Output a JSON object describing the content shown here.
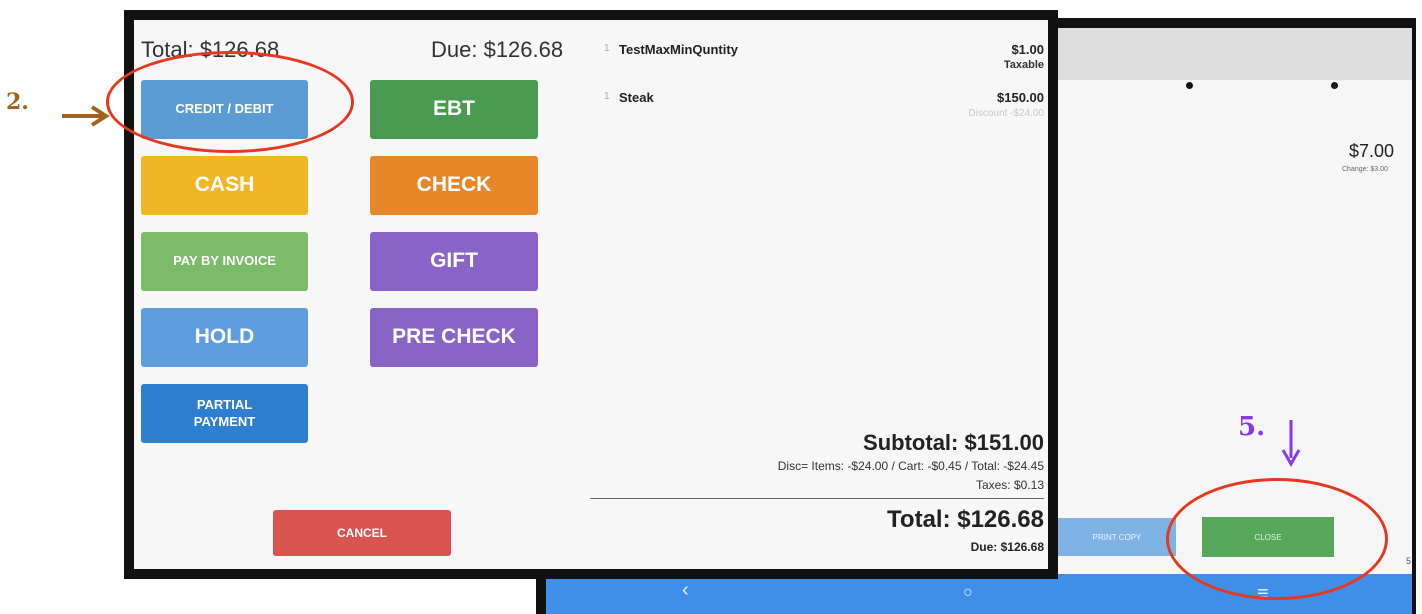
{
  "header": {
    "total": "Total: $126.68",
    "due": "Due: $126.68"
  },
  "payment_buttons": {
    "credit_debit": "CREDIT / DEBIT",
    "ebt": "EBT",
    "cash": "CASH",
    "check": "CHECK",
    "pay_by_invoice": "PAY BY INVOICE",
    "gift": "GIFT",
    "hold": "HOLD",
    "pre_check": "PRE CHECK",
    "partial_payment": "PARTIAL PAYMENT",
    "cancel": "CANCEL"
  },
  "cart": {
    "items": [
      {
        "prefix": "1",
        "name": "TestMaxMinQuntity",
        "price": "$1.00",
        "sub": "Taxable",
        "discount": ""
      },
      {
        "prefix": "1",
        "name": "Steak",
        "price": "$150.00",
        "sub": "",
        "discount": "Discount -$24.00"
      }
    ],
    "subtotal": "Subtotal: $151.00",
    "discount_line": "Disc= Items: -$24.00 / Cart: -$0.45 / Total: -$24.45",
    "taxes": "Taxes: $0.13",
    "total": "Total: $126.68",
    "due": "Due: $126.68"
  },
  "back_screen": {
    "amount": "$7.00",
    "change": "Change: $3.00",
    "print_copy_label": "PRINT COPY",
    "close_label": "CLOSE",
    "side_number": "5"
  },
  "android_nav": {
    "back_glyph": "‹",
    "home_glyph": "○",
    "menu_glyph": "≡"
  },
  "annotations": {
    "step2": "2.",
    "step5": "5."
  },
  "colors": {
    "credit_debit": "#5b9bd5",
    "ebt": "#4a9a4f",
    "cash": "#f0b623",
    "check": "#e8862a",
    "pay_by_invoice": "#7cbb6a",
    "gift": "#8a63c6",
    "hold": "#5f9ede",
    "pre_check": "#8a63c6",
    "partial_payment": "#2f7fd0",
    "cancel": "#d9534f",
    "annotation_red": "#e5381f",
    "step2_brown": "#a0631b",
    "step5_purple": "#8a38f0",
    "android_nav": "#3f8fe9"
  }
}
